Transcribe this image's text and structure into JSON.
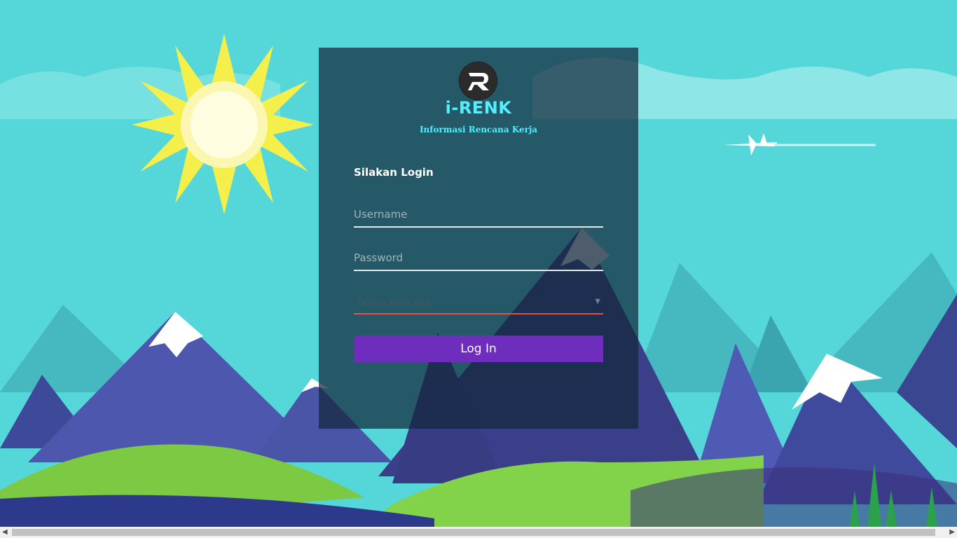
{
  "app": {
    "title": "i-RENK",
    "subtitle": "Informasi Rencana Kerja",
    "logo_icon": "r-logo-icon"
  },
  "login": {
    "heading": "Silakan Login",
    "username_placeholder": "Username",
    "password_placeholder": "Password",
    "year_placeholder": "Tahun Rencana",
    "button_label": "Log In"
  },
  "colors": {
    "accent": "#6f2dbd",
    "title": "#4ff0ff",
    "sky": "#55d6d8",
    "error_underline": "#d9534f"
  }
}
